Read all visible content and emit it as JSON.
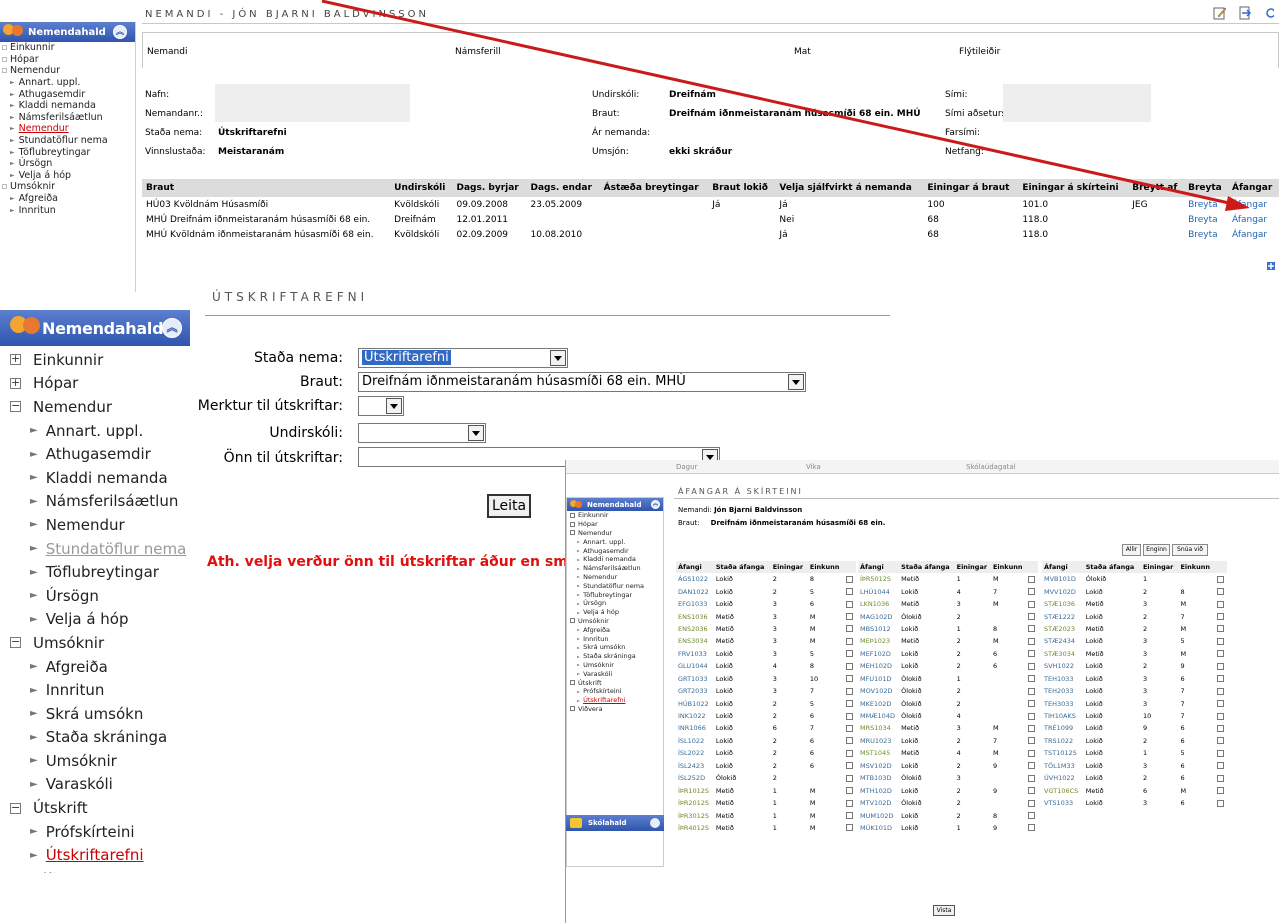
{
  "colors": {
    "sidebar_head": "#2f55ad",
    "link": "#2166b7",
    "warning": "#e01010",
    "active_nav": "#cc0000",
    "arrow": "#cc1a1a"
  },
  "student_panel": {
    "title": "NEMANDI - JÓN BJARNI BALDVINSSON",
    "tabs": [
      "Nemandi",
      "Námsferill",
      "Mat",
      "Flýtileiðir"
    ],
    "fields": {
      "nafn_label": "Nafn:",
      "nemandanr_label": "Nemandanr.:",
      "stada_label": "Staða nema:",
      "stada_value": "Útskriftarefni",
      "vinnslustada_label": "Vinnslustaða:",
      "vinnslustada_value": "Meistaranám",
      "undirskoli_label": "Undirskóli:",
      "undirskoli_value": "Dreifnám",
      "braut_label": "Braut:",
      "braut_value": "Dreifnám iðnmeistaranám húsasmíði 68 ein. MHÚ",
      "ar_label": "Ár nemanda:",
      "umsjon_label": "Umsjón:",
      "umsjon_value": "ekki skráður",
      "simi_label": "Sími:",
      "simi_adseturs_label": "Sími aðseturs:",
      "farsimi_label": "Farsími:",
      "netfang_label": "Netfang:"
    },
    "table": {
      "headers": [
        "Braut",
        "Undirskóli",
        "Dags. byrjar",
        "Dags. endar",
        "Ástæða breytingar",
        "Braut lokið",
        "Velja sjálfvirkt á nemanda",
        "Einingar á braut",
        "Einingar á skírteini",
        "Breytt af",
        "Breyta",
        "Áfangar"
      ],
      "rows": [
        [
          "HÚ03 Kvöldnám Húsasmíði",
          "Kvöldskóli",
          "09.09.2008",
          "23.05.2009",
          "",
          "Já",
          "Já",
          "100",
          "101.0",
          "JEG",
          "Breyta",
          "Áfangar"
        ],
        [
          "MHÚ Dreifnám iðnmeistaranám húsasmíði 68 ein.",
          "Dreifnám",
          "12.01.2011",
          "",
          "",
          "",
          "Nei",
          "68",
          "118.0",
          "",
          "Breyta",
          "Áfangar"
        ],
        [
          "MHÚ Kvöldnám iðnmeistaranám húsasmíði 68 ein.",
          "Kvöldskóli",
          "02.09.2009",
          "10.08.2010",
          "",
          "",
          "Já",
          "68",
          "118.0",
          "",
          "Breyta",
          "Áfangar"
        ]
      ]
    }
  },
  "sidebar": {
    "title": "Nemendahald",
    "items": [
      {
        "label": "Einkunnir",
        "level": 0,
        "sign": "+"
      },
      {
        "label": "Hópar",
        "level": 0,
        "sign": "+"
      },
      {
        "label": "Nemendur",
        "level": 0,
        "sign": "−"
      },
      {
        "label": "Annart. uppl.",
        "level": 1
      },
      {
        "label": "Athugasemdir",
        "level": 1
      },
      {
        "label": "Kladdi nemanda",
        "level": 1
      },
      {
        "label": "Námsferilsáætlun",
        "level": 1
      },
      {
        "label": "Nemendur",
        "level": 1
      },
      {
        "label": "Stundatöflur nema",
        "level": 1
      },
      {
        "label": "Töflubreytingar",
        "level": 1
      },
      {
        "label": "Úrsögn",
        "level": 1
      },
      {
        "label": "Velja á hóp",
        "level": 1
      },
      {
        "label": "Umsóknir",
        "level": 0,
        "sign": "−"
      },
      {
        "label": "Afgreiða",
        "level": 1
      },
      {
        "label": "Innritun",
        "level": 1
      },
      {
        "label": "Skrá umsókn",
        "level": 1
      },
      {
        "label": "Staða skráninga",
        "level": 1
      },
      {
        "label": "Umsóknir",
        "level": 1
      },
      {
        "label": "Varaskóli",
        "level": 1
      },
      {
        "label": "Útskrift",
        "level": 0,
        "sign": "−"
      },
      {
        "label": "Prófskírteini",
        "level": 1
      },
      {
        "label": "Útskriftarefni",
        "level": 1
      },
      {
        "label": "Viðvera",
        "level": 0,
        "sign": "+"
      }
    ],
    "bottom_title": "Skólahald"
  },
  "form": {
    "title": "ÚTSKRIFTAREFNI",
    "stada_label": "Staða nema:",
    "stada_value": "Útskriftarefni",
    "braut_label": "Braut:",
    "braut_value": "Dreifnám iðnmeistaranám húsasmíði 68 ein. MHÚ",
    "merktur_label": "Merktur til útskriftar:",
    "undirskoli_label": "Undirskóli:",
    "onn_label": "Önn til útskriftar:",
    "search_label": "Leita",
    "warning": "Ath. velja verður önn til útskriftar áður en smellt er á"
  },
  "overlay": {
    "bar_labels": [
      "Dagur",
      "Vika",
      "Skólaúdagatal"
    ],
    "title": "ÁFANGAR Á SKÍRTEINI",
    "nemandi_label": "Nemandi:",
    "nemandi_value": "Jón Bjarni Baldvinsson",
    "braut_label": "Braut:",
    "braut_value": "Dreifnám iðnmeistaranám húsasmíði 68 ein.",
    "buttons": [
      "Allir",
      "Enginn",
      "Snúa við"
    ],
    "col_headers": [
      "Áfangi",
      "Staða áfanga",
      "Einingar",
      "Einkunn"
    ],
    "save_label": "Vista",
    "col1": [
      [
        "ÁGS1022",
        "Lokið",
        "2",
        "8"
      ],
      [
        "DAN1022",
        "Lokið",
        "2",
        "5"
      ],
      [
        "EFG1033",
        "Lokið",
        "3",
        "6"
      ],
      [
        "ENS1036",
        "Metið",
        "3",
        "M"
      ],
      [
        "ENS2036",
        "Metið",
        "3",
        "M"
      ],
      [
        "ENS3034",
        "Metið",
        "3",
        "M"
      ],
      [
        "FRV1033",
        "Lokið",
        "3",
        "5"
      ],
      [
        "GLU1044",
        "Lokið",
        "4",
        "8"
      ],
      [
        "GRT1033",
        "Lokið",
        "3",
        "10"
      ],
      [
        "GRT2033",
        "Lokið",
        "3",
        "7"
      ],
      [
        "HÚB1022",
        "Lokið",
        "2",
        "5"
      ],
      [
        "INK1022",
        "Lokið",
        "2",
        "6"
      ],
      [
        "INR1066",
        "Lokið",
        "6",
        "7"
      ],
      [
        "ÍSL1022",
        "Lokið",
        "2",
        "6"
      ],
      [
        "ÍSL2022",
        "Lokið",
        "2",
        "6"
      ],
      [
        "ÍSL2423",
        "Lokið",
        "2",
        "6"
      ],
      [
        "ÍSL252D",
        "Ólokið",
        "2",
        ""
      ],
      [
        "ÍÞR1012S",
        "Metið",
        "1",
        "M"
      ],
      [
        "ÍÞR2012S",
        "Metið",
        "1",
        "M"
      ],
      [
        "ÍÞR3012S",
        "Metið",
        "1",
        "M"
      ],
      [
        "ÍÞR4012S",
        "Metið",
        "1",
        "M"
      ]
    ],
    "col2": [
      [
        "ÍÞR5012S",
        "Metið",
        "1",
        "M"
      ],
      [
        "LHÚ1044",
        "Lokið",
        "4",
        "7"
      ],
      [
        "LKN1036",
        "Metið",
        "3",
        "M"
      ],
      [
        "MAG102D",
        "Ólokið",
        "2",
        ""
      ],
      [
        "MBS1012",
        "Lokið",
        "1",
        "8"
      ],
      [
        "MEÞ1023",
        "Metið",
        "2",
        "M"
      ],
      [
        "MEF102D",
        "Lokið",
        "2",
        "6"
      ],
      [
        "MEH102D",
        "Lokið",
        "2",
        "6"
      ],
      [
        "MFU101D",
        "Ólokið",
        "1",
        ""
      ],
      [
        "MOV102D",
        "Ólokið",
        "2",
        ""
      ],
      [
        "MKE102D",
        "Ólokið",
        "2",
        ""
      ],
      [
        "MMÆ104D",
        "Ólokið",
        "4",
        ""
      ],
      [
        "MRS1034",
        "Metið",
        "3",
        "M"
      ],
      [
        "MRU1023",
        "Lokið",
        "2",
        "7"
      ],
      [
        "MST1045",
        "Metið",
        "4",
        "M"
      ],
      [
        "MSV102D",
        "Lokið",
        "2",
        "9"
      ],
      [
        "MTB103D",
        "Ólokið",
        "3",
        ""
      ],
      [
        "MTH102D",
        "Lokið",
        "2",
        "9"
      ],
      [
        "MTV102D",
        "Ólokið",
        "2",
        ""
      ],
      [
        "MUM102D",
        "Lokið",
        "2",
        "8"
      ],
      [
        "MÚK101D",
        "Lokið",
        "1",
        "9"
      ]
    ],
    "col3": [
      [
        "MVB101D",
        "Ólokið",
        "1",
        ""
      ],
      [
        "MVV102D",
        "Lokið",
        "2",
        "8"
      ],
      [
        "STÆ1036",
        "Metið",
        "3",
        "M"
      ],
      [
        "STÆ1222",
        "Lokið",
        "2",
        "7"
      ],
      [
        "STÆ2023",
        "Metið",
        "2",
        "M"
      ],
      [
        "STÆ2434",
        "Lokið",
        "3",
        "5"
      ],
      [
        "STÆ3034",
        "Metið",
        "3",
        "M"
      ],
      [
        "SVH1022",
        "Lokið",
        "2",
        "9"
      ],
      [
        "TEH1033",
        "Lokið",
        "3",
        "6"
      ],
      [
        "TEH2033",
        "Lokið",
        "3",
        "7"
      ],
      [
        "TEH3033",
        "Lokið",
        "3",
        "7"
      ],
      [
        "TIH10AKS",
        "Lokið",
        "10",
        "7"
      ],
      [
        "TRÉ1099",
        "Lokið",
        "9",
        "6"
      ],
      [
        "TRS1022",
        "Lokið",
        "2",
        "6"
      ],
      [
        "TST1012S",
        "Lokið",
        "1",
        "5"
      ],
      [
        "TÖL1M33",
        "Lokið",
        "3",
        "6"
      ],
      [
        "ÚVH1022",
        "Lokið",
        "2",
        "6"
      ],
      [
        "VGT106CS",
        "Metið",
        "6",
        "M"
      ],
      [
        "VTS1033",
        "Lokið",
        "3",
        "6"
      ]
    ]
  }
}
